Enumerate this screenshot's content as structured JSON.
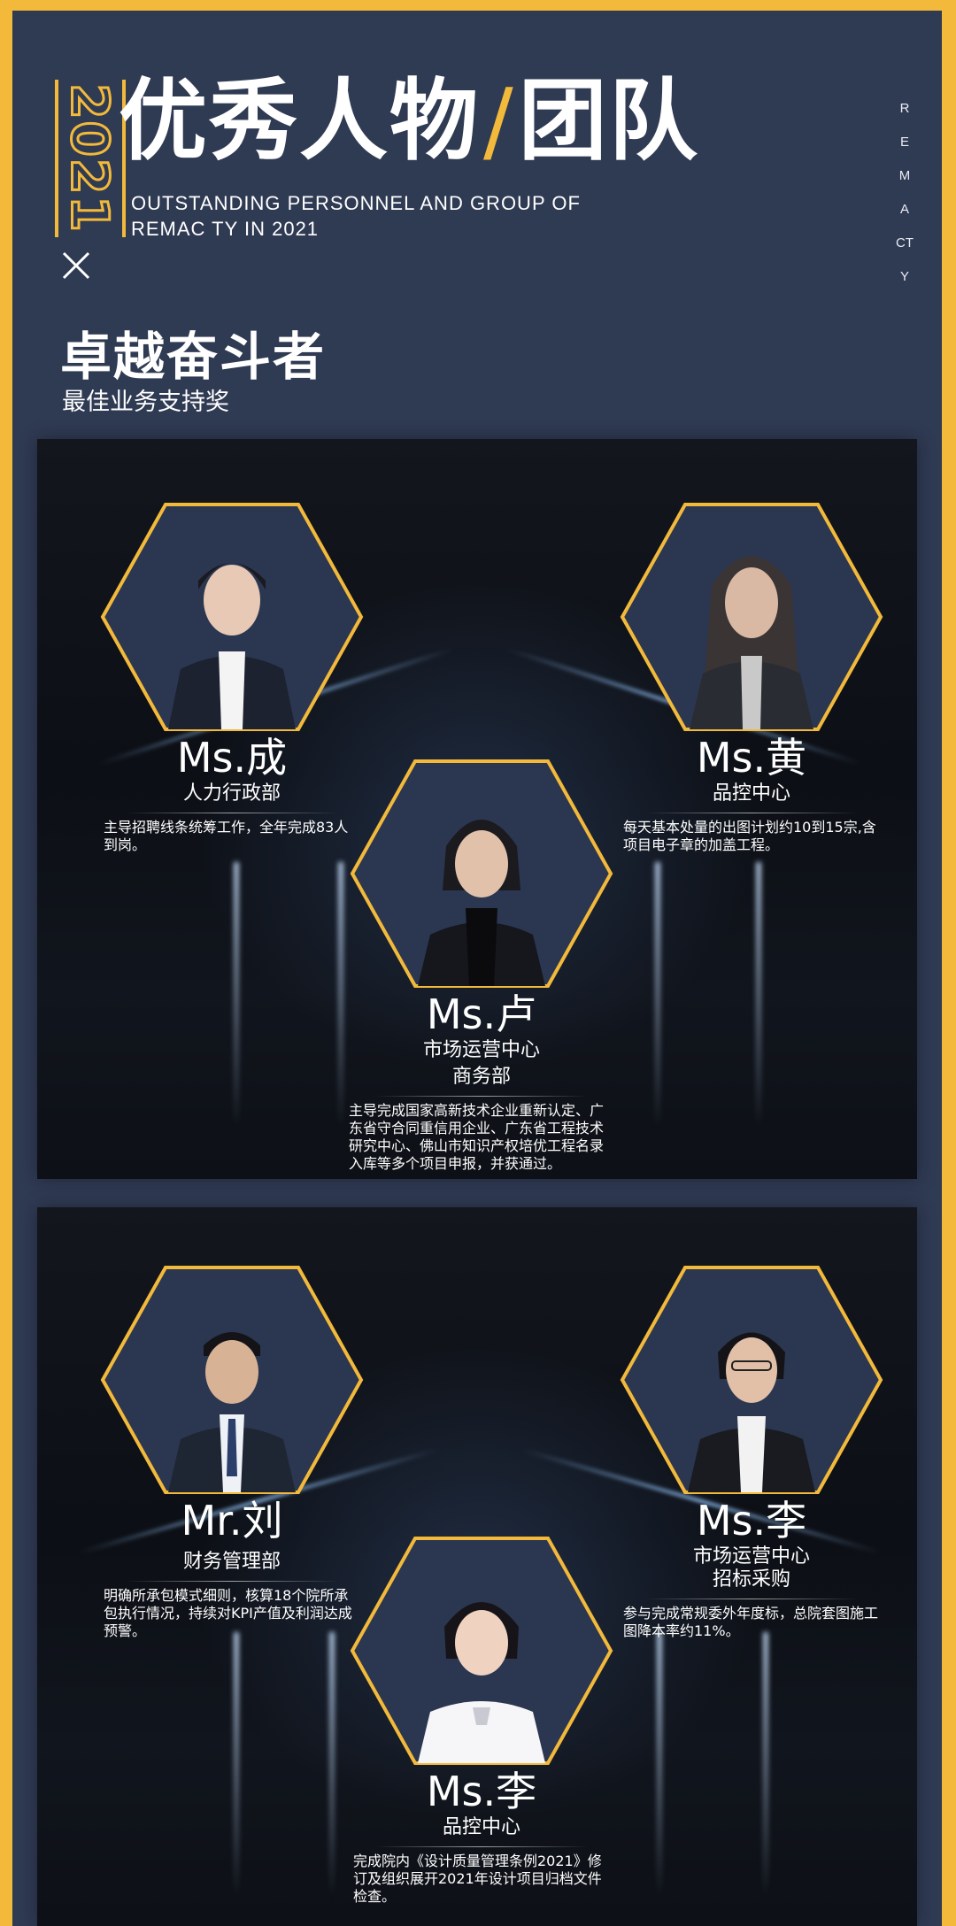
{
  "header": {
    "year": "2021",
    "title_part1": "优秀人物",
    "title_separator": "/",
    "title_part2": "团队",
    "subtitle": "OUTSTANDING PERSONNEL AND GROUP OF REMAC TY IN 2021",
    "side_text": "REMACTY"
  },
  "section": {
    "title": "卓越奋斗者",
    "subtitle": "最佳业务支持奖"
  },
  "panel1": {
    "people": [
      {
        "name": "Ms.成",
        "dept": "人力行政部",
        "dept2": "",
        "desc": "主导招聘线条统筹工作，全年完成83人到岗。"
      },
      {
        "name": "Ms.黄",
        "dept": "品控中心",
        "dept2": "",
        "desc": "每天基本处量的出图计划约10到15宗,含项目电子章的加盖工程。"
      },
      {
        "name": "Ms.卢",
        "dept": "市场运营中心",
        "dept2": "商务部",
        "desc": "主导完成国家高新技术企业重新认定、广东省守合同重信用企业、广东省工程技术研究中心、佛山市知识产权培优工程名录入库等多个项目申报，并获通过。"
      }
    ]
  },
  "panel2": {
    "people": [
      {
        "name": "Mr.刘",
        "dept": "财务管理部",
        "dept2": "",
        "desc": "明确所承包模式细则，核算18个院所承包执行情况，持续对KPI产值及利润达成预警。"
      },
      {
        "name": "Ms.李",
        "dept": "市场运营中心",
        "dept2": "招标采购",
        "desc": "参与完成常规委外年度标，总院套图施工图降本率约11%。"
      },
      {
        "name": "Ms.李",
        "dept": "品控中心",
        "dept2": "",
        "desc": "完成院内《设计质量管理条例2021》修订及组织展开2021年设计项目归档文件检查。"
      }
    ]
  },
  "colors": {
    "gold": "#f2b93b",
    "navy": "#2f3a53",
    "hex_fill": "#2b3650",
    "panel_dark": "#0e1117"
  }
}
